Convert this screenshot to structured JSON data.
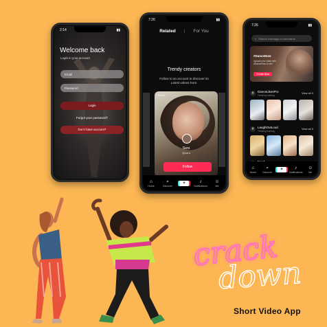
{
  "phone_login": {
    "status_time": "2:14",
    "title": "Welcome back",
    "subtitle": "Login in your account",
    "email_placeholder": "Email",
    "password_placeholder": "Password",
    "login_label": "Login",
    "forgot_label": "Forgot your password?",
    "signup_label": "Don't have account?"
  },
  "phone_related": {
    "status_time": "7:26",
    "tab_related": "Related",
    "tab_separator": "|",
    "tab_foryou": "For You",
    "title": "Trendy creators",
    "subtitle": "Follow to an account to discover its Latest videos here.",
    "card_source": "TikTok",
    "card_name": "Sara",
    "card_handle": "@sara",
    "follow_label": "Follow",
    "nav": [
      {
        "icon": "⌂",
        "label": "Home"
      },
      {
        "icon": "⌕",
        "label": "Discover"
      },
      {
        "icon": "+",
        "label": ""
      },
      {
        "icon": "♪",
        "label": "Notifications"
      },
      {
        "icon": "☺",
        "label": "Me"
      }
    ]
  },
  "phone_discover": {
    "status_time": "7:26",
    "search_placeholder": "Search hashtags or username",
    "banner_tag": "#DanceNow",
    "banner_desc": "Upload new video with #DanceNow to win",
    "banner_button": "Create Now",
    "sections": [
      {
        "icon": "#",
        "title": "DanceLikesPro",
        "subtitle": "Trending hashtag",
        "view": "View all 3"
      },
      {
        "icon": "#",
        "title": "LaughOutLoud",
        "subtitle": "Trending hashtag",
        "view": "View all 3"
      },
      {
        "icon": "#",
        "title": "Food",
        "subtitle": "",
        "view": "View all 3"
      }
    ],
    "nav": [
      {
        "icon": "⌂",
        "label": "Home"
      },
      {
        "icon": "⌕",
        "label": "Discover"
      },
      {
        "icon": "+",
        "label": ""
      },
      {
        "icon": "♪",
        "label": "Notifications"
      },
      {
        "icon": "☺",
        "label": "Me"
      }
    ]
  },
  "branding": {
    "word1": "crack",
    "word2": "down",
    "tagline": "Short Video App"
  },
  "colors": {
    "background": "#fcb754",
    "accent": "#fd2c55",
    "neon_pink": "#ff6fc8"
  }
}
